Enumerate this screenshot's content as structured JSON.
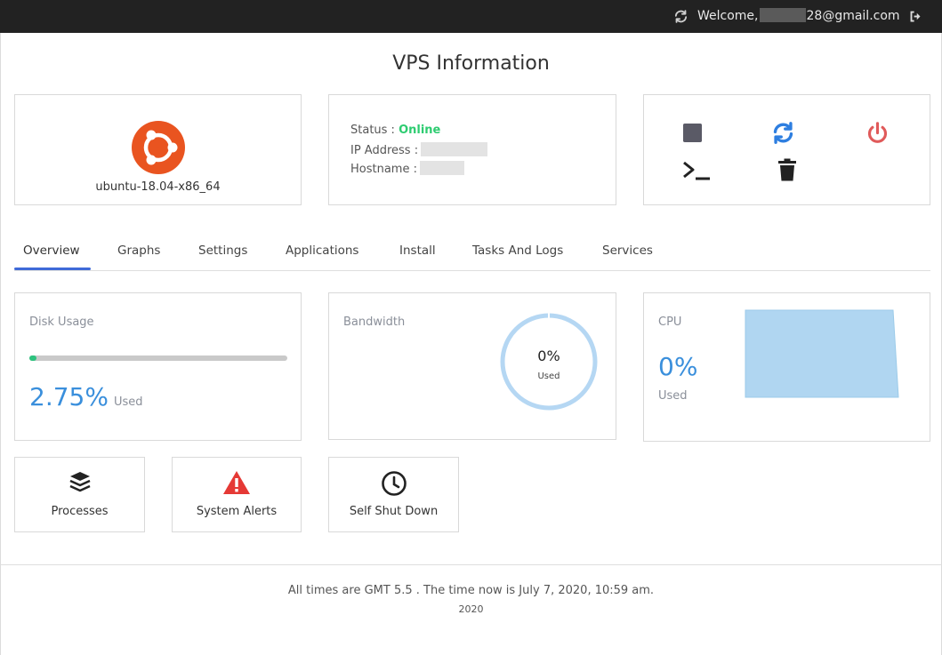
{
  "header": {
    "welcome_prefix": "Welcome,",
    "email_suffix": "28@gmail.com",
    "icons": [
      "refresh-icon",
      "logout-icon"
    ]
  },
  "page_title": "VPS Information",
  "os": {
    "name": "ubuntu-18.04-x86_64",
    "logo_color": "#e95420"
  },
  "server_info": {
    "status_label": "Status :",
    "status_value": "Online",
    "ip_label": "IP Address :",
    "hostname_label": "Hostname :"
  },
  "actions": {
    "icons": [
      "stop-icon",
      "restart-icon",
      "power-icon",
      "terminal-icon",
      "trash-icon"
    ],
    "colors": {
      "stop": "#5a5a66",
      "restart": "#2d7ee0",
      "power": "#e05a5a",
      "terminal": "#222222",
      "trash": "#222222"
    }
  },
  "tabs": [
    {
      "label": "Overview",
      "active": true
    },
    {
      "label": "Graphs"
    },
    {
      "label": "Settings"
    },
    {
      "label": "Applications"
    },
    {
      "label": "Install"
    },
    {
      "label": "Tasks And Logs"
    },
    {
      "label": "Services"
    }
  ],
  "disk": {
    "label": "Disk Usage",
    "percent_text": "2.75%",
    "used_label": "Used",
    "percent": 2.75
  },
  "bandwidth": {
    "label": "Bandwidth",
    "value_text": "0%",
    "sub_label": "Used",
    "percent": 0
  },
  "cpu": {
    "label": "CPU",
    "value_text": "0%",
    "used_label": "Used"
  },
  "tools": [
    {
      "label": "Processes",
      "icon": "layers-icon"
    },
    {
      "label": "System Alerts",
      "icon": "warning-icon"
    },
    {
      "label": "Self Shut Down",
      "icon": "clock-icon"
    }
  ],
  "footer": {
    "time_text": "All times are GMT 5.5 . The time now is July 7, 2020, 10:59 am.",
    "year": "2020"
  },
  "colors": {
    "accent": "#3f6ad8",
    "online": "#2ecc71",
    "primary_value": "#3a8fdc",
    "disk_fill": "#2ec27e",
    "alert": "#e53935"
  }
}
